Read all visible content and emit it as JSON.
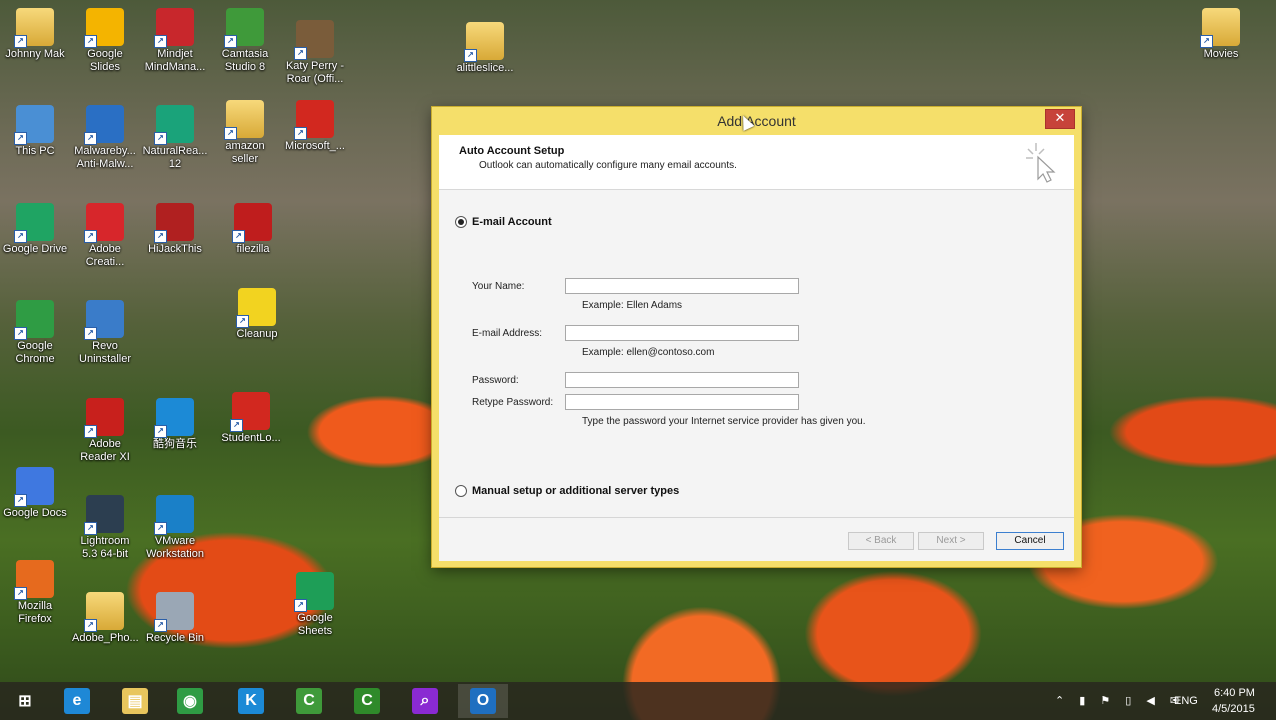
{
  "desktop_icons": [
    {
      "label": "Johnny Mak",
      "icon": "user-folder-icon",
      "color": "#d4a84a"
    },
    {
      "label": "Google Slides",
      "icon": "google-slides-icon",
      "color": "#f4b400"
    },
    {
      "label": "Mindjet MindMana...",
      "icon": "mindjet-icon",
      "color": "#c8272c"
    },
    {
      "label": "Camtasia Studio 8",
      "icon": "camtasia-icon",
      "color": "#3f9a3a"
    },
    {
      "label": "Katy Perry - Roar (Offi...",
      "icon": "video-icon",
      "color": "#7a5c3a"
    },
    {
      "label": "alittleslice...",
      "icon": "folder-icon",
      "color": "#e8c65d"
    },
    {
      "label": "Movies",
      "icon": "folder-icon",
      "color": "#e8c65d"
    },
    {
      "label": "This PC",
      "icon": "computer-icon",
      "color": "#4a8fd4"
    },
    {
      "label": "Malwareby... Anti-Malw...",
      "icon": "malwarebytes-icon",
      "color": "#2a6fc4"
    },
    {
      "label": "NaturalRea... 12",
      "icon": "naturalreader-icon",
      "color": "#1aa37a"
    },
    {
      "label": "amazon seller",
      "icon": "folder-icon",
      "color": "#e8c65d"
    },
    {
      "label": "Microsoft_...",
      "icon": "pdf-icon",
      "color": "#d2281f"
    },
    {
      "label": "Google Drive",
      "icon": "google-drive-icon",
      "color": "#1fa463"
    },
    {
      "label": "Adobe Creati...",
      "icon": "creative-cloud-icon",
      "color": "#d7262b"
    },
    {
      "label": "HiJackThis",
      "icon": "hijackthis-icon",
      "color": "#b02020"
    },
    {
      "label": "filezilla",
      "icon": "filezilla-icon",
      "color": "#bf1d1d"
    },
    {
      "label": "Google Chrome",
      "icon": "chrome-icon",
      "color": "#2f9c44"
    },
    {
      "label": "Revo Uninstaller",
      "icon": "revo-icon",
      "color": "#3a7cc9"
    },
    {
      "label": "Cleanup",
      "icon": "cleanup-icon",
      "color": "#f2d320"
    },
    {
      "label": "Adobe Reader XI",
      "icon": "adobe-reader-icon",
      "color": "#c8201c"
    },
    {
      "label": "酷狗音乐",
      "icon": "kugou-icon",
      "color": "#1c8ad6"
    },
    {
      "label": "StudentLo...",
      "icon": "pdf-icon",
      "color": "#d2281f"
    },
    {
      "label": "Google Docs",
      "icon": "google-docs-icon",
      "color": "#3f78e0"
    },
    {
      "label": "Lightroom 5.3 64-bit",
      "icon": "lightroom-icon",
      "color": "#2c3e50"
    },
    {
      "label": "VMware Workstation",
      "icon": "vmware-icon",
      "color": "#1a80c8"
    },
    {
      "label": "Mozilla Firefox",
      "icon": "firefox-icon",
      "color": "#e66a1e"
    },
    {
      "label": "Adobe_Pho...",
      "icon": "folder-icon",
      "color": "#e8c65d"
    },
    {
      "label": "Recycle Bin",
      "icon": "recycle-bin-icon",
      "color": "#9aa7b5"
    },
    {
      "label": "Google Sheets",
      "icon": "google-sheets-icon",
      "color": "#1e9e57"
    }
  ],
  "dialog": {
    "title": "Add Account",
    "close_glyph": "✕",
    "header_title": "Auto Account Setup",
    "header_subtitle": "Outlook can automatically configure many email accounts.",
    "email_option": "E-mail Account",
    "your_name_label": "Your Name:",
    "your_name_value": "",
    "your_name_example": "Example: Ellen Adams",
    "email_label": "E-mail Address:",
    "email_value": "",
    "email_example": "Example: ellen@contoso.com",
    "password_label": "Password:",
    "retype_label": "Retype Password:",
    "password_hint": "Type the password your Internet service provider has given you.",
    "manual_option": "Manual setup or additional server types",
    "back_label": "< Back",
    "next_label": "Next >",
    "cancel_label": "Cancel"
  },
  "taskbar": {
    "apps": [
      {
        "name": "start-button",
        "glyph": "⊞",
        "color": "#ffffff"
      },
      {
        "name": "internet-explorer",
        "glyph": "e",
        "color": "#1e88d6"
      },
      {
        "name": "file-explorer",
        "glyph": "▤",
        "color": "#e8c65d"
      },
      {
        "name": "chrome",
        "glyph": "◉",
        "color": "#2f9c44"
      },
      {
        "name": "kugou",
        "glyph": "K",
        "color": "#1c8ad6"
      },
      {
        "name": "camtasia-recorder",
        "glyph": "C",
        "color": "#3f9a3a"
      },
      {
        "name": "camtasia-studio",
        "glyph": "C",
        "color": "#2f8a2a"
      },
      {
        "name": "search-app",
        "glyph": "⌕",
        "color": "#8a2ad2"
      },
      {
        "name": "outlook",
        "glyph": "O",
        "color": "#1f6fc0"
      }
    ],
    "language": "ENG",
    "time": "6:40 PM",
    "date": "4/5/2015"
  }
}
